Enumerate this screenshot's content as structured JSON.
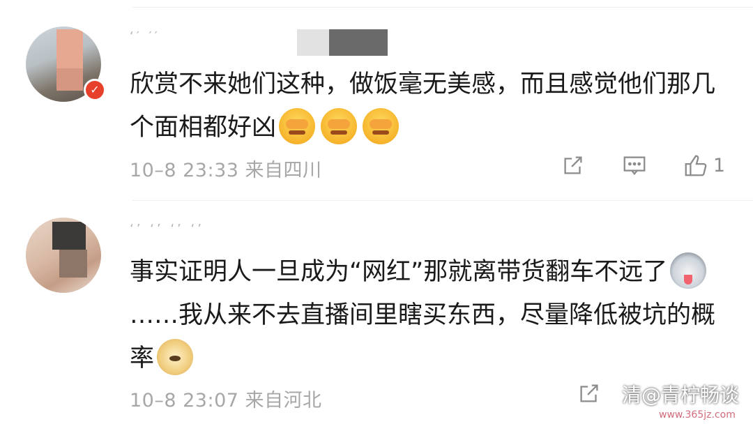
{
  "comments": [
    {
      "name_hint": "‘′ ′′",
      "text_before": "欣赏不来她们这种，做饭毫无美感，而且感觉他们那几个面相都好凶",
      "emoji_icons": [
        "facepalm-emoji",
        "facepalm-emoji",
        "facepalm-emoji"
      ],
      "time": "10–8 23:33",
      "location": "来自四川",
      "like_count": "1"
    },
    {
      "name_hint": "‘’ ‘’ ‘’ ‘’",
      "text_part1": "事实证明人一旦成为“网红”那就离带货翻车不远了",
      "emoji1": "husky-emoji",
      "text_part2": "……我从来不去直播间里瞎买东西，尽量降低被坑的概率",
      "emoji2": "doge-emoji",
      "time": "10–8 23:07",
      "location": "来自河北"
    }
  ],
  "watermark": {
    "text": "清@青柠畅谈",
    "url": "www.365jz.com"
  },
  "colors": {
    "text": "#1a1a1a",
    "meta": "#a7a7a7",
    "icon": "#8b8b8b",
    "badge": "#e8412b"
  }
}
